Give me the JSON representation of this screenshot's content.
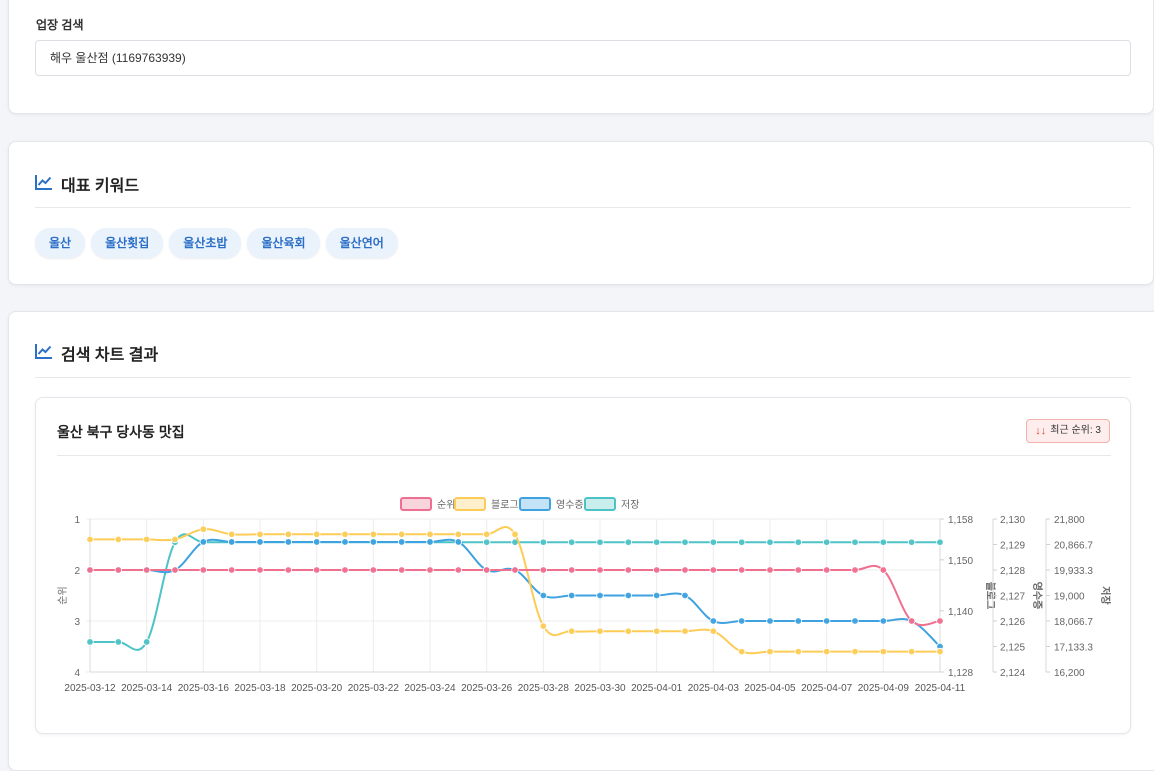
{
  "search": {
    "label": "업장 검색",
    "value": "해우 울산점 (1169763939)"
  },
  "keywords": {
    "title": "대표 키워드",
    "items": [
      "울산",
      "울산횟집",
      "울산초밥",
      "울산육회",
      "울산연어"
    ]
  },
  "results": {
    "title": "검색 차트 결과",
    "card": {
      "title": "울산 북구 당사동 맛집",
      "badge_label": "최근 순위: 3"
    }
  },
  "chart_data": {
    "type": "line",
    "title": "울산 북구 당사동 맛집",
    "x": [
      "2025-03-12",
      "2025-03-13",
      "2025-03-14",
      "2025-03-15",
      "2025-03-16",
      "2025-03-17",
      "2025-03-18",
      "2025-03-19",
      "2025-03-20",
      "2025-03-21",
      "2025-03-22",
      "2025-03-23",
      "2025-03-24",
      "2025-03-25",
      "2025-03-26",
      "2025-03-27",
      "2025-03-28",
      "2025-03-29",
      "2025-03-30",
      "2025-03-31",
      "2025-04-01",
      "2025-04-02",
      "2025-04-03",
      "2025-04-04",
      "2025-04-05",
      "2025-04-06",
      "2025-04-07",
      "2025-04-08",
      "2025-04-09",
      "2025-04-10",
      "2025-04-11"
    ],
    "x_tick_labels": [
      "2025-03-12",
      "2025-03-14",
      "2025-03-16",
      "2025-03-18",
      "2025-03-20",
      "2025-03-22",
      "2025-03-24",
      "2025-03-26",
      "2025-03-28",
      "2025-03-30",
      "2025-04-01",
      "2025-04-03",
      "2025-04-05",
      "2025-04-07",
      "2025-04-09",
      "2025-04-11"
    ],
    "legend_position": "top",
    "grid": true,
    "axes": [
      {
        "id": "rank",
        "label": "순위",
        "position": "left",
        "reverse": true,
        "range": [
          1,
          4
        ],
        "ticks": [
          "1",
          "2",
          "3",
          "4"
        ]
      },
      {
        "id": "blog",
        "label": "블로그",
        "position": "right",
        "range": [
          1128,
          1158
        ],
        "ticks": [
          "1,158",
          "1,150",
          "1,140",
          "1,128"
        ]
      },
      {
        "id": "receipt",
        "label": "영수증",
        "position": "right",
        "range": [
          2124,
          2130
        ],
        "ticks": [
          "2,130",
          "2,129",
          "2,128",
          "2,127",
          "2,126",
          "2,125",
          "2,124"
        ]
      },
      {
        "id": "save",
        "label": "저장",
        "position": "right",
        "range": [
          16200,
          21800
        ],
        "ticks": [
          "21,800",
          "20,866.7",
          "19,933.3",
          "19,000",
          "18,066.7",
          "17,133.3",
          "16,200"
        ]
      }
    ],
    "series": [
      {
        "name": "순위",
        "axis": "rank",
        "color": "#f06f8f",
        "values": [
          2,
          2,
          2,
          2,
          2,
          2,
          2,
          2,
          2,
          2,
          2,
          2,
          2,
          2,
          2,
          2,
          2,
          2,
          2,
          2,
          2,
          2,
          2,
          2,
          2,
          2,
          2,
          2,
          2,
          3,
          3
        ]
      },
      {
        "name": "블로그",
        "axis": "blog",
        "color": "#fccc57",
        "values": [
          1154,
          1154,
          1154,
          1154,
          1156,
          1155,
          1155,
          1155,
          1155,
          1155,
          1155,
          1155,
          1155,
          1155,
          1155,
          1155,
          1137,
          1136,
          1136,
          1136,
          1136,
          1136,
          1136,
          1132,
          1132,
          1132,
          1132,
          1132,
          1132,
          1132,
          1132
        ]
      },
      {
        "name": "영수증",
        "axis": "receipt",
        "color": "#3fa2e0",
        "values": [
          2128,
          2128,
          2128,
          2128,
          2129.1,
          2129.1,
          2129.1,
          2129.1,
          2129.1,
          2129.1,
          2129.1,
          2129.1,
          2129.1,
          2129.1,
          2128,
          2128,
          2127,
          2127,
          2127,
          2127,
          2127,
          2127,
          2126,
          2126,
          2126,
          2126,
          2126,
          2126,
          2126,
          2126,
          2125
        ]
      },
      {
        "name": "저장",
        "axis": "save",
        "color": "#4ec3c7",
        "values": [
          17300,
          17300,
          17300,
          20950,
          20950,
          20950,
          20950,
          20950,
          20950,
          20950,
          20950,
          20950,
          20950,
          20950,
          20950,
          20950,
          20950,
          20950,
          20950,
          20950,
          20950,
          20950,
          20950,
          20950,
          20950,
          20950,
          20950,
          20950,
          20950,
          20950,
          20950
        ]
      }
    ]
  }
}
